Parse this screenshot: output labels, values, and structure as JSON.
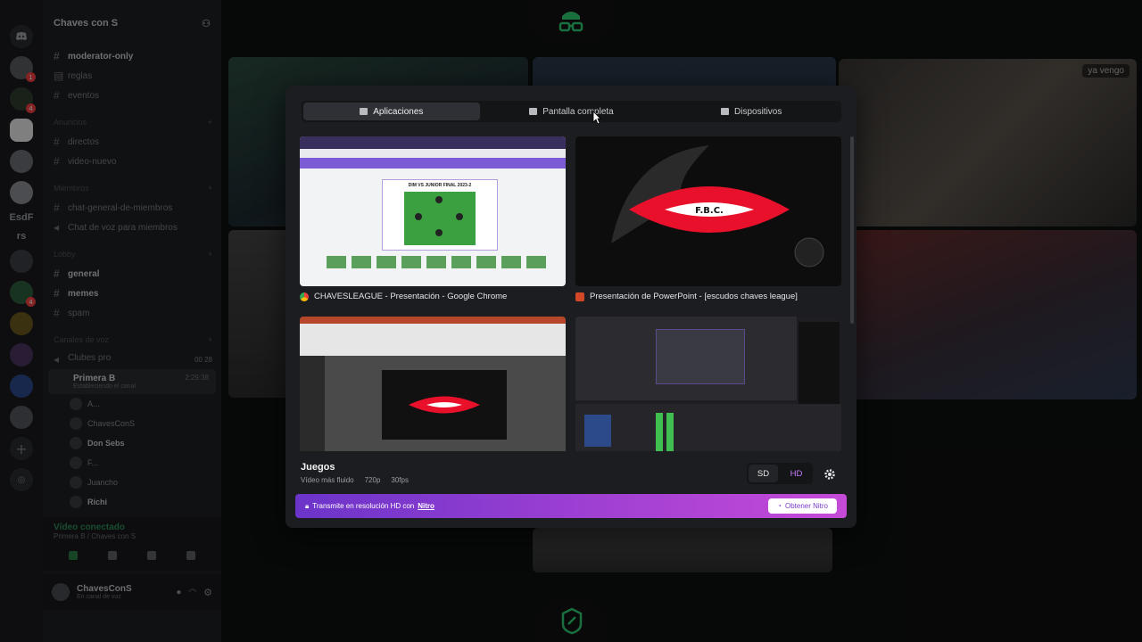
{
  "sidebar": {
    "guild_name": "Chaves con S",
    "channels_top": [
      {
        "name": "moderator-only",
        "bright": true
      },
      {
        "name": "reglas",
        "bright": false
      },
      {
        "name": "eventos",
        "bright": false
      }
    ],
    "category_anuncios": "Anuncios",
    "channels_anuncios": [
      {
        "name": "directos"
      },
      {
        "name": "video-nuevo"
      }
    ],
    "category_miembros": "Miembros",
    "channels_miembros": [
      {
        "name": "chat-general-de-miembros"
      },
      {
        "name": "Chat de voz para miembros"
      }
    ],
    "category_lobby": "Lobby",
    "channels_lobby": [
      {
        "name": "general",
        "bright": true
      },
      {
        "name": "memes",
        "bright": true
      },
      {
        "name": "spam",
        "bright": false
      }
    ],
    "category_voz": "Canales de voz",
    "voice_channel_1": "Clubes pro",
    "voice_channel_1_counts": "00  28",
    "voice_room": {
      "name": "Primera B",
      "status": "Estableciendo el canal",
      "timer": "2:29:38"
    },
    "voice_users": [
      "A...",
      "ChavesConS",
      "Don Sebs",
      "F...",
      "Juancho",
      "Richi"
    ]
  },
  "voice_connected": {
    "title": "Vídeo conectado",
    "subtitle": "Primera B / Chaves con S"
  },
  "user": {
    "name": "ChavesConS",
    "status": "En canal de voz"
  },
  "rail": {
    "text_items": [
      "EsdF",
      "rs"
    ]
  },
  "tile_label": "ya vengo",
  "modal": {
    "tabs": [
      {
        "label": "Aplicaciones",
        "active": true
      },
      {
        "label": "Pantalla completa",
        "active": false
      },
      {
        "label": "Dispositivos",
        "active": false
      }
    ],
    "windows": [
      {
        "title": "CHAVESLEAGUE - Presentación - Google Chrome",
        "icon_color": "#4285f4"
      },
      {
        "title": "Presentación de PowerPoint - [escudos chaves league]",
        "icon_color": "#d24726"
      },
      {
        "title": "",
        "icon_color": "#d24726"
      },
      {
        "title": "",
        "icon_color": "#302e31"
      }
    ],
    "slide_title": "DIM VS JUNIOR FINAL 2023-2",
    "crest_text": "F.B.C.",
    "quality": {
      "title": "Juegos",
      "desc": "Vídeo más fluido",
      "res": "720p",
      "fps": "30fps"
    },
    "res_sd": "SD",
    "res_hd": "HD",
    "nitro_text": "Transmite en resolución HD con",
    "nitro_link": "Nitro",
    "nitro_button": "Obtener Nitro"
  },
  "colors": {
    "accent_green": "#2ecc71",
    "nitro_purple": "#9b3fd2",
    "crest_red": "#e8102a"
  }
}
